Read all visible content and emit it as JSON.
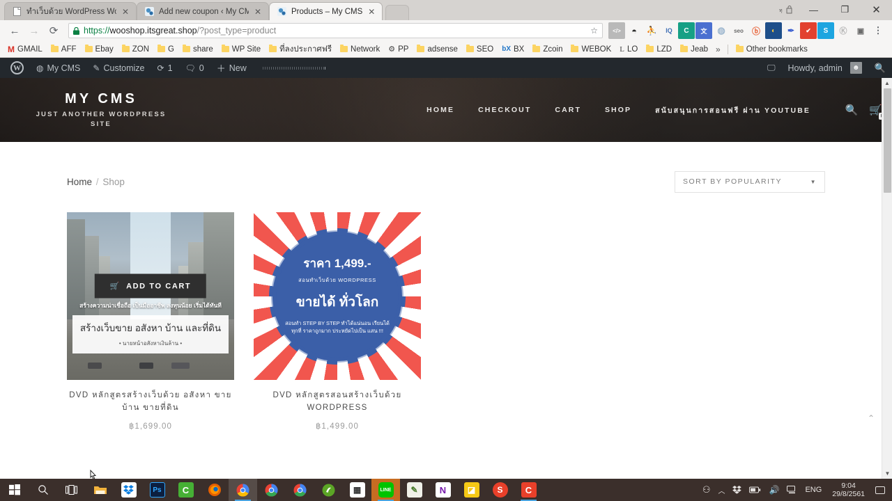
{
  "browser": {
    "tabs": [
      {
        "title": "ทำเว็บด้วย WordPress Woo",
        "favicon": "page-icon",
        "active": false
      },
      {
        "title": "Add new coupon ‹ My CM",
        "favicon": "wordpress-icon",
        "active": false
      },
      {
        "title": "Products – My CMS",
        "favicon": "wordpress-icon",
        "active": true
      }
    ],
    "window_controls": {
      "minimize": "—",
      "maximize": "❐",
      "close": "✕"
    },
    "nav": {
      "back": "←",
      "forward": "→",
      "reload": "⟳"
    },
    "omnibox": {
      "scheme": "https://",
      "host": "wooshop.itsgreat.shop",
      "path": "/?post_type=product",
      "lock_icon": "lock-icon",
      "star_icon": "star-icon"
    },
    "extensions": [
      {
        "name": "code-extension",
        "glyph": "</>",
        "bg": "#b9b9b9",
        "fg": "#ffffff"
      },
      {
        "name": "owl-extension",
        "glyph": "◓",
        "bg": "transparent",
        "fg": "#2b2b2b"
      },
      {
        "name": "statue-extension",
        "glyph": "⛹",
        "bg": "transparent",
        "fg": "#5a8fd6"
      },
      {
        "name": "iq-extension",
        "glyph": "IQ",
        "bg": "transparent",
        "fg": "#3f6fb5"
      },
      {
        "name": "c-extension",
        "glyph": "C",
        "bg": "#16a085",
        "fg": "#ffffff"
      },
      {
        "name": "translate-extension",
        "glyph": "文",
        "bg": "#4a6fd0",
        "fg": "#ffffff"
      },
      {
        "name": "globe-extension",
        "glyph": "◍",
        "bg": "transparent",
        "fg": "#9fb8cf"
      },
      {
        "name": "seo-extension",
        "glyph": "seo",
        "bg": "transparent",
        "fg": "#6b6b6b"
      },
      {
        "name": "bitly-extension",
        "glyph": "b",
        "bg": "transparent",
        "fg": "#e8663d"
      },
      {
        "name": "moon-extension",
        "glyph": "◐",
        "bg": "#1e4f8a",
        "fg": "#f5c542"
      },
      {
        "name": "pen-extension",
        "glyph": "✎",
        "bg": "transparent",
        "fg": "#3b5fd0"
      },
      {
        "name": "check-extension",
        "glyph": "✔",
        "bg": "#e2412f",
        "fg": "#ffffff"
      },
      {
        "name": "s-extension",
        "glyph": "S",
        "bg": "#1da5e0",
        "fg": "#ffffff"
      },
      {
        "name": "k-extension",
        "glyph": "K",
        "bg": "#b6b6b6",
        "fg": "#ffffff"
      },
      {
        "name": "camera-extension",
        "glyph": "◎",
        "bg": "transparent",
        "fg": "#6b6b6b"
      },
      {
        "name": "chrome-menu",
        "glyph": "⋮",
        "bg": "transparent",
        "fg": "#5f6368"
      }
    ],
    "bookmarks": [
      {
        "label": "GMAIL",
        "icon": "gmail-icon"
      },
      {
        "label": "AFF",
        "icon": "folder-icon"
      },
      {
        "label": "Ebay",
        "icon": "folder-icon"
      },
      {
        "label": "ZON",
        "icon": "folder-icon"
      },
      {
        "label": "G",
        "icon": "folder-icon"
      },
      {
        "label": "share",
        "icon": "folder-icon"
      },
      {
        "label": "WP Site",
        "icon": "folder-icon"
      },
      {
        "label": "ที่ลงประกาศฟรี",
        "icon": "folder-icon"
      },
      {
        "label": "Network",
        "icon": "folder-icon"
      },
      {
        "label": "PP",
        "icon": "pp-icon"
      },
      {
        "label": "adsense",
        "icon": "folder-icon"
      },
      {
        "label": "SEO",
        "icon": "folder-icon"
      },
      {
        "label": "BX",
        "icon": "bx-icon"
      },
      {
        "label": "Zcoin",
        "icon": "folder-icon"
      },
      {
        "label": "WEBOK",
        "icon": "folder-icon"
      },
      {
        "label": "LO",
        "icon": "lo-icon"
      },
      {
        "label": "LZD",
        "icon": "folder-icon"
      },
      {
        "label": "Jeab",
        "icon": "folder-icon"
      }
    ],
    "bookmarks_overflow": "»",
    "other_bookmarks": {
      "label": "Other bookmarks",
      "icon": "folder-icon"
    }
  },
  "adminbar": {
    "logo_icon": "wordpress-logo-icon",
    "site_name": "My CMS",
    "site_icon": "dashboard-icon",
    "customize": "Customize",
    "customize_icon": "brush-icon",
    "updates_icon": "updates-icon",
    "updates_count": "1",
    "comments_icon": "comment-icon",
    "comments_count": "0",
    "new_icon": "plus-icon",
    "new_label": "New",
    "howdy": "Howdy, admin",
    "avatar_icon": "avatar-icon",
    "search_icon": "search-icon",
    "notice_icon": "screen-icon"
  },
  "site": {
    "brand_title": "MY CMS",
    "brand_tagline": "JUST ANOTHER WORDPRESS SITE",
    "nav": [
      {
        "label": "HOME"
      },
      {
        "label": "CHECKOUT"
      },
      {
        "label": "CART"
      },
      {
        "label": "SHOP"
      },
      {
        "label": "สนับสนุนการสอนฟรี ผ่าน YOUTUBE"
      }
    ],
    "search_icon": "search-icon",
    "cart_icon": "cart-icon",
    "cart_count": "0"
  },
  "shop": {
    "breadcrumb": {
      "home": "Home",
      "separator": "/",
      "current": "Shop"
    },
    "orderby": {
      "selected": "SORT BY POPULARITY",
      "caret_icon": "chevron-down-icon"
    },
    "products": [
      {
        "title": "DVD หลักสูตรสร้างเว็บด้วย อสังหา ขาย บ้าน ขายที่ดิน",
        "price": "฿1,699.00",
        "add_to_cart": "ADD TO CART",
        "cart_icon": "cart-icon",
        "image": {
          "kind": "city-street-photo",
          "band_text": "สร้างความน่าเชื่อถือ เป็นมืออาชีพ ลงทุนน้อย เริ่มได้ทันที",
          "headline": "สร้างเว็บขาย อสังหา บ้าน และที่ดิน",
          "subline": "• นายหน้าอสังหาเงินล้าน •"
        }
      },
      {
        "title": "DVD หลักสูตรสอนสร้างเว็บด้วย WORDPRESS",
        "price": "฿1,499.00",
        "image": {
          "kind": "sunburst-badge",
          "badge_line1": "ราคา 1,499.-",
          "badge_line2": "สอนทำเว็บด้วย WORDPRESS",
          "badge_line3": "ขายได้ ทั่วโลก",
          "badge_line4": "สอนทำ STEP BY STEP ทำได้แน่นอน เรียนได้ทุกที่ ราคาถูกมาก ประหยัดไปเป็น แสน !!!",
          "ray_color": "#f1564e",
          "badge_color": "#3b5fa8"
        }
      }
    ],
    "scroll_top_icon": "chevron-up-icon"
  },
  "taskbar": {
    "items": [
      {
        "name": "start-button",
        "icon": "windows-icon",
        "glyph": "⊞",
        "bg": "transparent",
        "fg": "#ffffff"
      },
      {
        "name": "search-button",
        "icon": "search-icon",
        "glyph": "🔍",
        "bg": "transparent",
        "fg": "#ffffff"
      },
      {
        "name": "task-view-button",
        "icon": "task-view-icon",
        "glyph": "❏",
        "bg": "transparent",
        "fg": "#ffffff"
      },
      {
        "name": "file-explorer",
        "icon": "folder-icon",
        "glyph": "🗀",
        "bg": "transparent",
        "fg": "#f4b942"
      },
      {
        "name": "dropbox",
        "icon": "dropbox-icon",
        "glyph": "❖",
        "bg": "#ffffff",
        "fg": "#0d7ee0"
      },
      {
        "name": "photoshop",
        "icon": "photoshop-icon",
        "glyph": "Ps",
        "bg": "#0c1f3f",
        "fg": "#31a8ff"
      },
      {
        "name": "camtasia",
        "icon": "camtasia-icon",
        "glyph": "C",
        "bg": "#46b035",
        "fg": "#ffffff"
      },
      {
        "name": "firefox",
        "icon": "firefox-icon",
        "glyph": "◉",
        "bg": "transparent",
        "fg": "#e66000"
      },
      {
        "name": "chrome-active",
        "icon": "chrome-icon",
        "glyph": "◍",
        "bg": "transparent",
        "fg": "#4285f4"
      },
      {
        "name": "chrome-2",
        "icon": "chrome-icon",
        "glyph": "◍",
        "bg": "transparent",
        "fg": "#4285f4"
      },
      {
        "name": "chrome-3",
        "icon": "chrome-icon",
        "glyph": "◍",
        "bg": "transparent",
        "fg": "#4285f4"
      },
      {
        "name": "evernote",
        "icon": "evernote-icon",
        "glyph": "🐘",
        "bg": "#5ba525",
        "fg": "#ffffff"
      },
      {
        "name": "calculator",
        "icon": "calculator-icon",
        "glyph": "▦",
        "bg": "#ffffff",
        "fg": "#333333"
      },
      {
        "name": "line",
        "icon": "line-icon",
        "glyph": "LINE",
        "bg": "#00c300",
        "fg": "#ffffff"
      },
      {
        "name": "notepad",
        "icon": "notepad-icon",
        "glyph": "✎",
        "bg": "#eeeeee",
        "fg": "#4a7b2c"
      },
      {
        "name": "onenote",
        "icon": "onenote-icon",
        "glyph": "N",
        "bg": "#ffffff",
        "fg": "#7719aa"
      },
      {
        "name": "yellow-app",
        "icon": "lightning-icon",
        "glyph": "⚡",
        "bg": "#f6c915",
        "fg": "#ffffff"
      },
      {
        "name": "snagit",
        "icon": "snagit-icon",
        "glyph": "S",
        "bg": "#e8402a",
        "fg": "#ffffff"
      },
      {
        "name": "camtasia-2",
        "icon": "camtasia-icon",
        "glyph": "C",
        "bg": "#e8402a",
        "fg": "#ffffff"
      }
    ],
    "tray": {
      "people_icon": "people-icon",
      "chevron_icon": "chevron-up-icon",
      "dropbox_icon": "dropbox-icon",
      "battery_icon": "battery-icon",
      "volume_icon": "volume-icon",
      "network_icon": "network-icon",
      "language": "ENG",
      "time": "9:04",
      "date": "29/8/2561",
      "action_center_icon": "action-center-icon"
    }
  }
}
